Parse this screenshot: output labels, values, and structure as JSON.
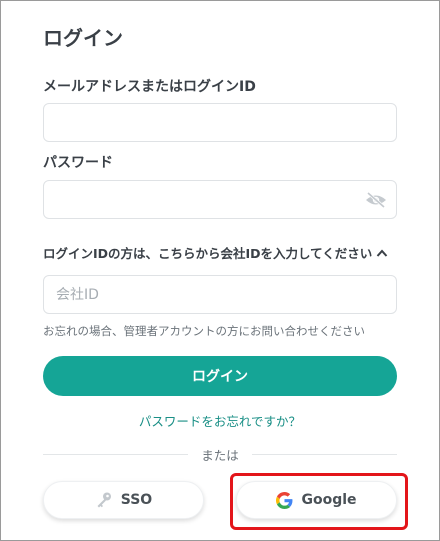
{
  "page": {
    "title": "ログイン"
  },
  "form": {
    "email_label": "メールアドレスまたはログインID",
    "email_value": "",
    "password_label": "パスワード",
    "password_value": "",
    "company_toggle_label": "ログインIDの方は、こちらから会社IDを入力してください",
    "company_placeholder": "会社ID",
    "company_value": "",
    "forgot_hint": "お忘れの場合、管理者アカウントの方にお問い合わせください",
    "login_button": "ログイン",
    "forgot_password_link": "パスワードをお忘れですか？"
  },
  "divider": {
    "text": "または"
  },
  "sso": {
    "sso_label": "SSO",
    "sso_icon": "key-icon",
    "google_label": "Google",
    "google_icon": "google-logo-icon"
  },
  "colors": {
    "accent": "#15a596",
    "link": "#1a8f86",
    "highlight": "#e3151a"
  }
}
